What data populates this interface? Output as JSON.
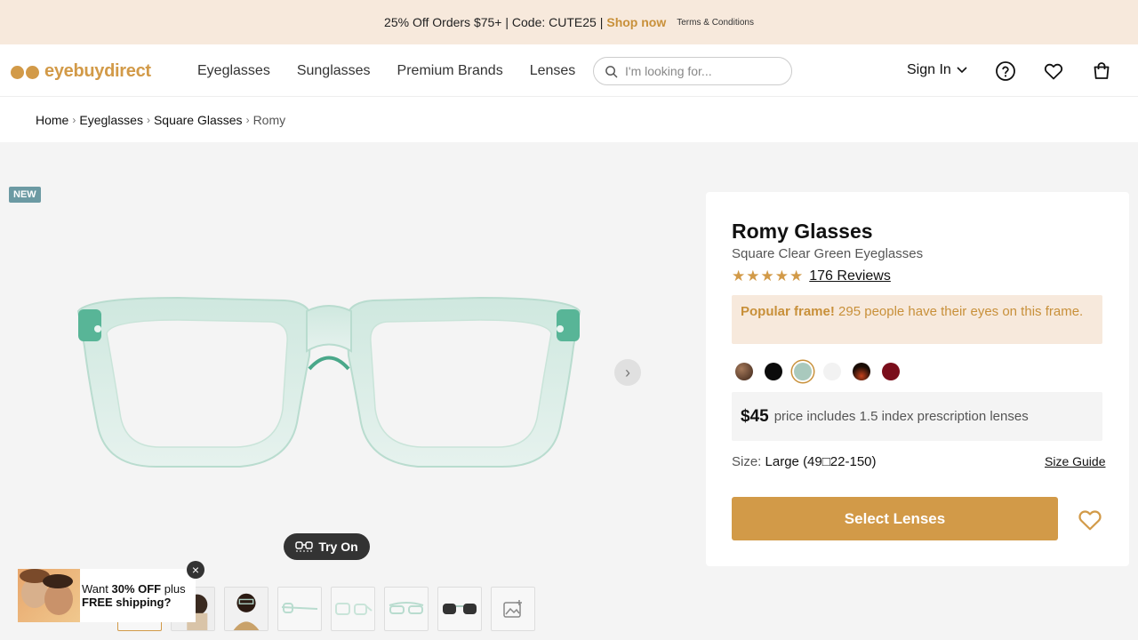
{
  "promo": {
    "text": "25% Off Orders $75+ | Code: CUTE25 |",
    "shop_label": "Shop now",
    "terms_label": "Terms & Conditions"
  },
  "header": {
    "logo_text": "eyebuydirect",
    "nav": [
      "Eyeglasses",
      "Sunglasses",
      "Premium Brands",
      "Lenses"
    ],
    "search_placeholder": "I'm looking for...",
    "signin_label": "Sign In",
    "icons": [
      "help-icon",
      "heart-icon",
      "cart-icon"
    ]
  },
  "breadcrumb": [
    "Home",
    "Eyeglasses",
    "Square Glasses",
    "Romy"
  ],
  "gallery": {
    "badge": "NEW",
    "tryon_label": "Try On",
    "thumbnail_count": 8
  },
  "popup": {
    "line1_prefix": "Want ",
    "line1_bold": "30% OFF",
    "line1_suffix": " plus",
    "line2": "FREE shipping?"
  },
  "product": {
    "title": "Romy Glasses",
    "subtitle": "Square Clear Green Eyeglasses",
    "rating": 5,
    "reviews_label": "176 Reviews",
    "popular_bold": "Popular frame!",
    "popular_text": " 295 people have their eyes on this frame.",
    "swatches": [
      "#6a4a36",
      "#0b0b0b",
      "#a9c9bd",
      "#f2f2f2",
      "#1a0c06",
      "#7a0d1b"
    ],
    "selected_swatch": 2,
    "price": "$45",
    "price_note": "price includes 1.5 index prescription lenses",
    "size_label": "Size:",
    "size_value": "Large (49□22-150)",
    "size_guide": "Size Guide",
    "select_button": "Select Lenses"
  },
  "colors": {
    "accent": "#d29a48",
    "promo_bg": "#f7e9dc",
    "badge_bg": "#6c9aa3"
  }
}
